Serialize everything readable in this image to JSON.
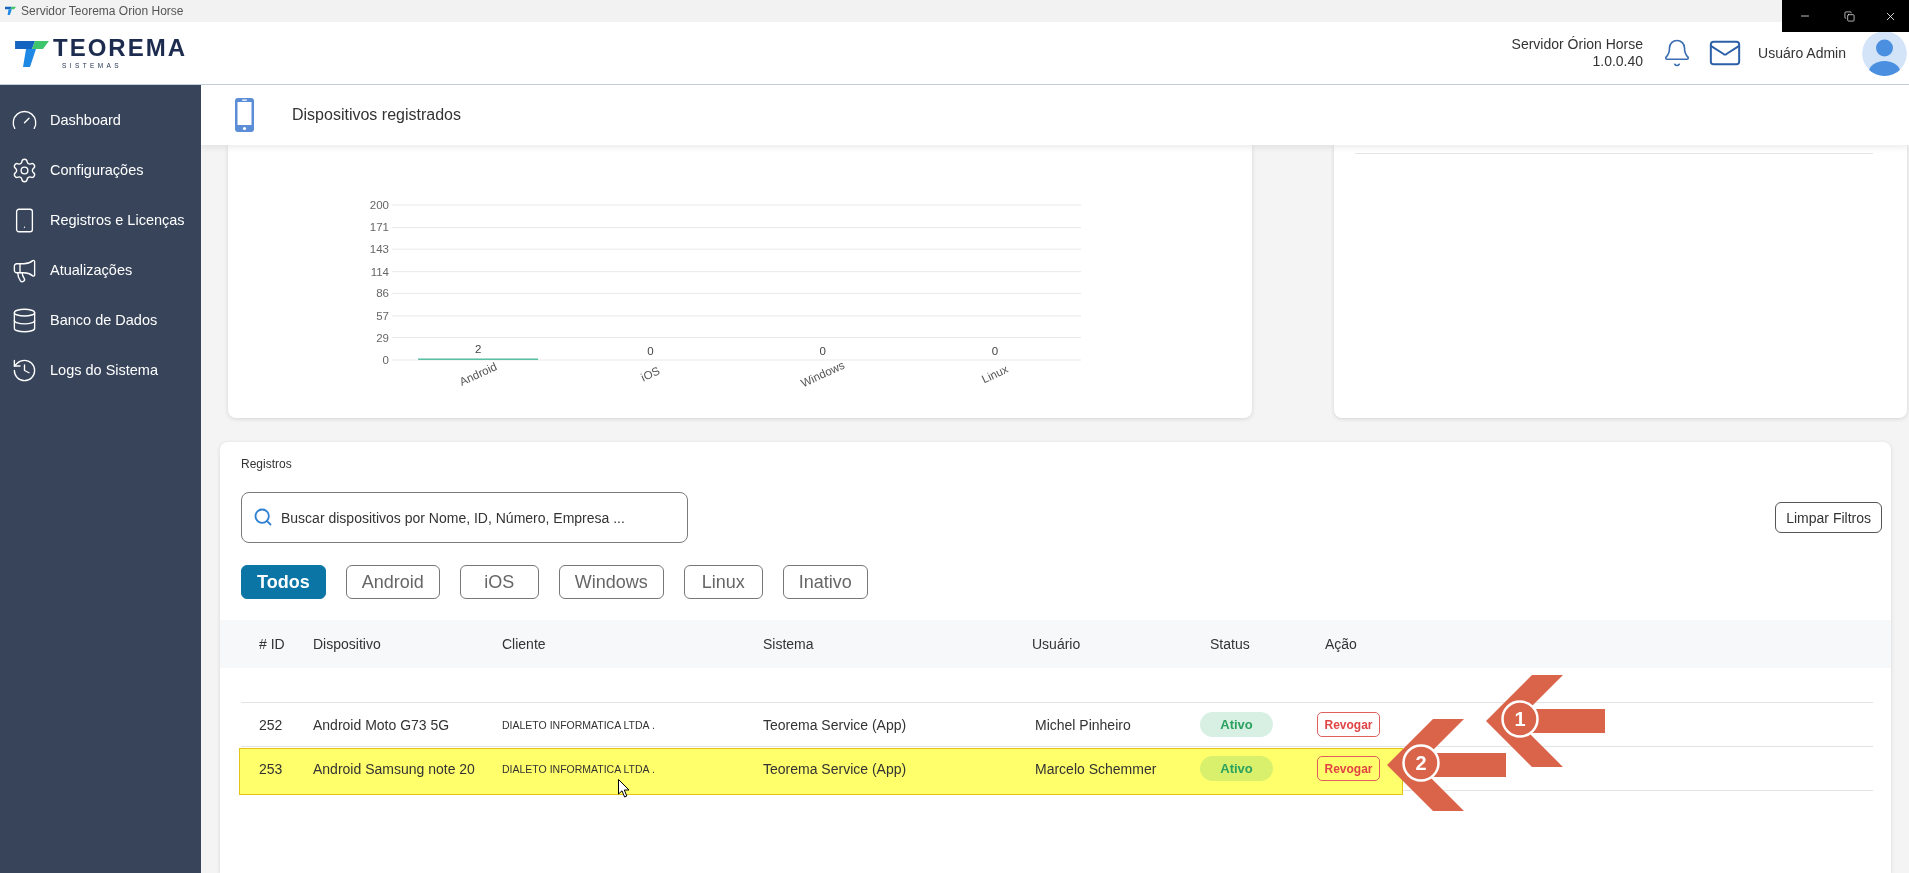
{
  "window": {
    "title": "Servidor Teorema Orion Horse"
  },
  "header": {
    "logo": {
      "name": "TEOREMA",
      "tagline": "SISTEMAS"
    },
    "server": {
      "name": "Servidor Órion Horse",
      "version": "1.0.0.40"
    },
    "user": {
      "name": "Usuáro Admin"
    }
  },
  "sidebar": {
    "items": [
      {
        "label": "Dashboard"
      },
      {
        "label": "Configurações"
      },
      {
        "label": "Registros e Licenças"
      },
      {
        "label": "Atualizações"
      },
      {
        "label": "Banco de Dados"
      },
      {
        "label": "Logs do Sistema"
      }
    ]
  },
  "page": {
    "title": "Dispositivos registrados"
  },
  "chart_card": {
    "chart_data": {
      "type": "bar",
      "categories": [
        "Android",
        "iOS",
        "Windows",
        "Linux"
      ],
      "values": [
        2,
        0,
        0,
        0
      ],
      "ylim": [
        0,
        200
      ],
      "yticks": [
        0,
        29,
        57,
        86,
        114,
        143,
        171,
        200
      ],
      "grid": true,
      "data_labels": true
    }
  },
  "registros": {
    "title": "Registros",
    "search": {
      "placeholder": "Buscar dispositivos por Nome, ID, Número, Empresa ..."
    },
    "clear_button": "Limpar Filtros",
    "filters": [
      {
        "label": "Todos",
        "selected": true
      },
      {
        "label": "Android",
        "selected": false
      },
      {
        "label": "iOS",
        "selected": false
      },
      {
        "label": "Windows",
        "selected": false
      },
      {
        "label": "Linux",
        "selected": false
      },
      {
        "label": "Inativo",
        "selected": false
      }
    ],
    "table": {
      "columns": [
        "# ID",
        "Dispositivo",
        "Cliente",
        "Sistema",
        "Usuário",
        "Status",
        "Ação"
      ],
      "rows": [
        {
          "id": "252",
          "device": "Android Moto G73 5G",
          "client": "DIALETO INFORMATICA LTDA .",
          "system": "Teorema Service (App)",
          "user": "Michel Pinheiro",
          "status": "Ativo",
          "action": "Revogar",
          "highlighted": false,
          "callout": "1"
        },
        {
          "id": "253",
          "device": "Android Samsung note 20",
          "client": "DIALETO INFORMATICA LTDA .",
          "system": "Teorema Service (App)",
          "user": "Marcelo Schemmer",
          "status": "Ativo",
          "action": "Revogar",
          "highlighted": true,
          "callout": "2"
        }
      ]
    }
  }
}
